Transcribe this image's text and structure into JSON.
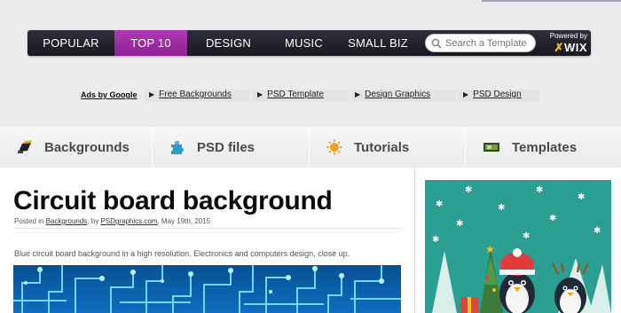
{
  "nav": {
    "items": [
      {
        "label": "POPULAR",
        "active": false
      },
      {
        "label": "TOP 10",
        "active": true
      },
      {
        "label": "DESIGN",
        "active": false
      },
      {
        "label": "MUSIC",
        "active": false
      },
      {
        "label": "SMALL BIZ",
        "active": false
      }
    ],
    "search": {
      "placeholder": "Search a Template"
    },
    "powered_by": {
      "label": "Powered by",
      "brand": "WIX"
    }
  },
  "ads": {
    "label": "Ads by Google",
    "links": [
      "Free Backgrounds",
      "PSD Template",
      "Design Graphics",
      "PSD Design"
    ]
  },
  "categories": [
    {
      "label": "Backgrounds",
      "icon": "brush-icon"
    },
    {
      "label": "PSD files",
      "icon": "puzzle-icon"
    },
    {
      "label": "Tutorials",
      "icon": "sun-icon"
    },
    {
      "label": "Templates",
      "icon": "template-icon"
    }
  ],
  "post": {
    "title": "Circuit board background",
    "meta": {
      "prefix": "Posted in",
      "category": "Backgrounds",
      "by": ", by",
      "author": "PSDgraphics.com",
      "date": ", May 19th, 2015"
    },
    "description": "Blue circuit board background in a high resolution. Electronics and computers design, close up."
  },
  "colors": {
    "nav_active": "#9b2ba1",
    "nav_bg": "#1f1f28",
    "page_bg": "#ececec",
    "circuit_blue": "#0b5da8",
    "ad_teal": "#2a9d8f"
  }
}
